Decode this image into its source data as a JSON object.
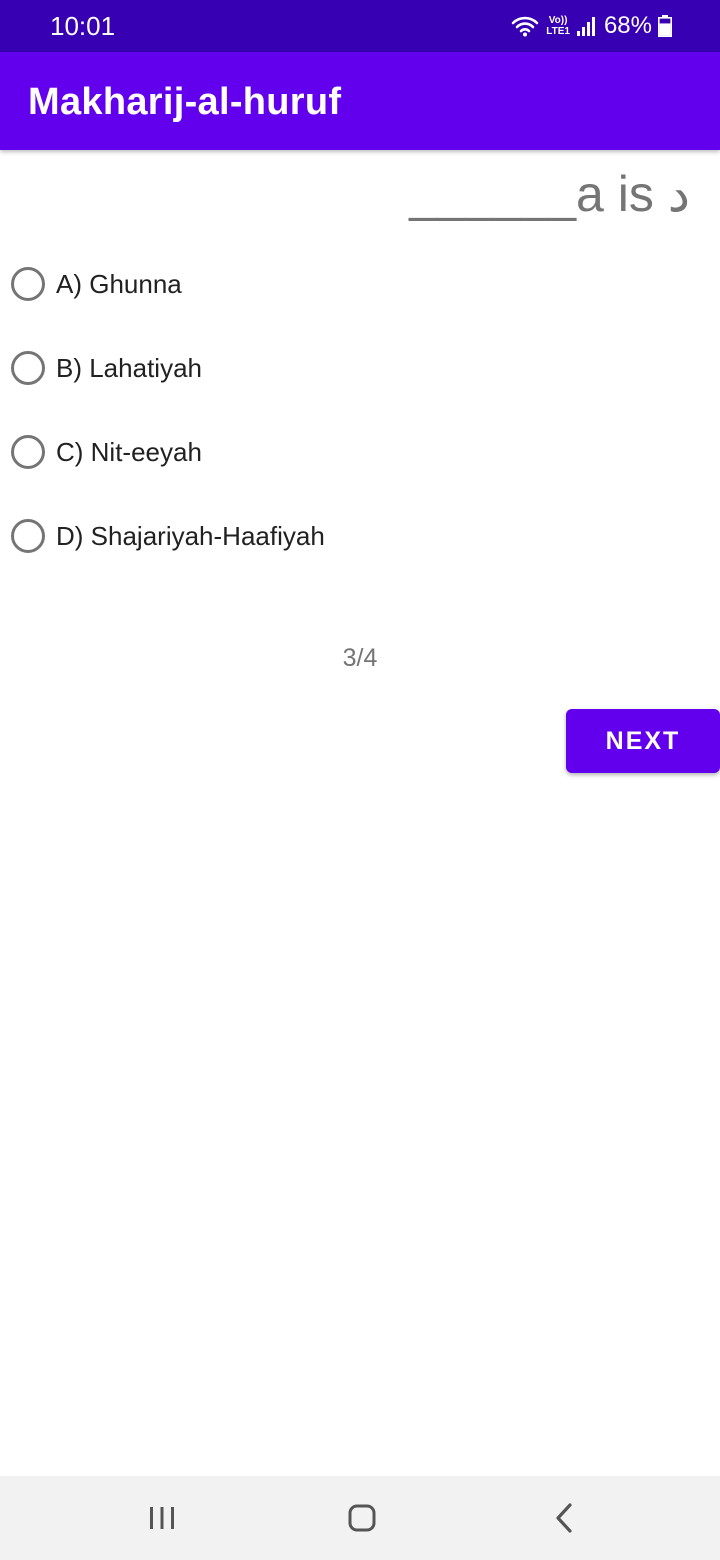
{
  "status_bar": {
    "time": "10:01",
    "lte_top": "Vo))",
    "lte_bottom": "LTE1",
    "battery_percent": "68%",
    "battery_level": 0.68,
    "icons": [
      "wifi-icon",
      "signal-icon",
      "battery-icon"
    ]
  },
  "app_bar": {
    "title": "Makharij-al-huruf",
    "color": "#6200ee"
  },
  "question": {
    "text": "______a is د"
  },
  "options": [
    {
      "label": "A) Ghunna",
      "selected": false
    },
    {
      "label": "B) Lahatiyah",
      "selected": false
    },
    {
      "label": "C) Nit-eeyah",
      "selected": false
    },
    {
      "label": "D) Shajariyah-Haafiyah",
      "selected": false
    }
  ],
  "progress": {
    "text": "3/4"
  },
  "next_button": {
    "label": "NEXT"
  },
  "nav_bar": {
    "icons": [
      "recents-icon",
      "home-icon",
      "back-icon"
    ]
  },
  "colors": {
    "status_bar": "#3700b3",
    "accent": "#6200ee",
    "text_secondary": "#757575"
  }
}
